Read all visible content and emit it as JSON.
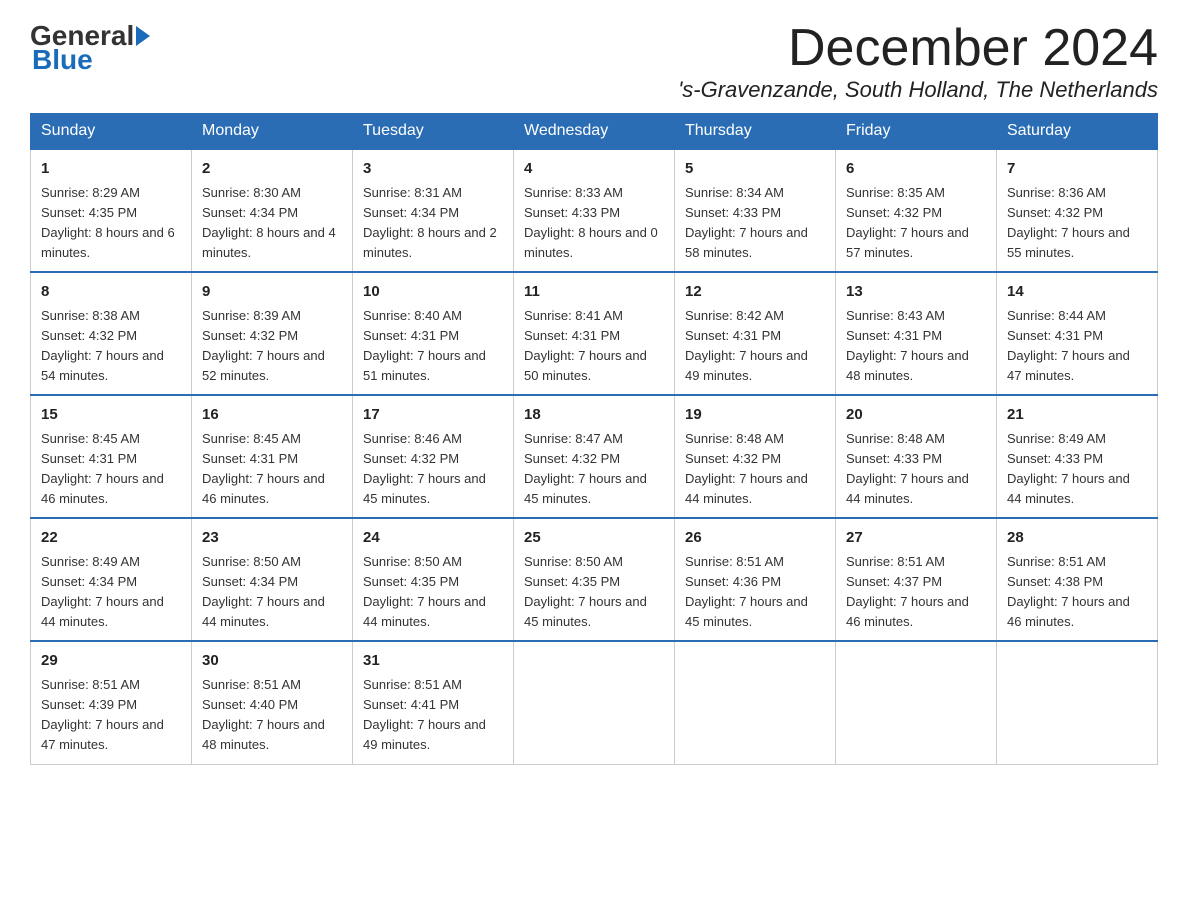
{
  "header": {
    "logo_general": "General",
    "logo_blue": "Blue",
    "month_title": "December 2024",
    "location": "'s-Gravenzande, South Holland, The Netherlands"
  },
  "weekdays": [
    "Sunday",
    "Monday",
    "Tuesday",
    "Wednesday",
    "Thursday",
    "Friday",
    "Saturday"
  ],
  "weeks": [
    [
      {
        "day": "1",
        "sunrise": "8:29 AM",
        "sunset": "4:35 PM",
        "daylight": "8 hours and 6 minutes."
      },
      {
        "day": "2",
        "sunrise": "8:30 AM",
        "sunset": "4:34 PM",
        "daylight": "8 hours and 4 minutes."
      },
      {
        "day": "3",
        "sunrise": "8:31 AM",
        "sunset": "4:34 PM",
        "daylight": "8 hours and 2 minutes."
      },
      {
        "day": "4",
        "sunrise": "8:33 AM",
        "sunset": "4:33 PM",
        "daylight": "8 hours and 0 minutes."
      },
      {
        "day": "5",
        "sunrise": "8:34 AM",
        "sunset": "4:33 PM",
        "daylight": "7 hours and 58 minutes."
      },
      {
        "day": "6",
        "sunrise": "8:35 AM",
        "sunset": "4:32 PM",
        "daylight": "7 hours and 57 minutes."
      },
      {
        "day": "7",
        "sunrise": "8:36 AM",
        "sunset": "4:32 PM",
        "daylight": "7 hours and 55 minutes."
      }
    ],
    [
      {
        "day": "8",
        "sunrise": "8:38 AM",
        "sunset": "4:32 PM",
        "daylight": "7 hours and 54 minutes."
      },
      {
        "day": "9",
        "sunrise": "8:39 AM",
        "sunset": "4:32 PM",
        "daylight": "7 hours and 52 minutes."
      },
      {
        "day": "10",
        "sunrise": "8:40 AM",
        "sunset": "4:31 PM",
        "daylight": "7 hours and 51 minutes."
      },
      {
        "day": "11",
        "sunrise": "8:41 AM",
        "sunset": "4:31 PM",
        "daylight": "7 hours and 50 minutes."
      },
      {
        "day": "12",
        "sunrise": "8:42 AM",
        "sunset": "4:31 PM",
        "daylight": "7 hours and 49 minutes."
      },
      {
        "day": "13",
        "sunrise": "8:43 AM",
        "sunset": "4:31 PM",
        "daylight": "7 hours and 48 minutes."
      },
      {
        "day": "14",
        "sunrise": "8:44 AM",
        "sunset": "4:31 PM",
        "daylight": "7 hours and 47 minutes."
      }
    ],
    [
      {
        "day": "15",
        "sunrise": "8:45 AM",
        "sunset": "4:31 PM",
        "daylight": "7 hours and 46 minutes."
      },
      {
        "day": "16",
        "sunrise": "8:45 AM",
        "sunset": "4:31 PM",
        "daylight": "7 hours and 46 minutes."
      },
      {
        "day": "17",
        "sunrise": "8:46 AM",
        "sunset": "4:32 PM",
        "daylight": "7 hours and 45 minutes."
      },
      {
        "day": "18",
        "sunrise": "8:47 AM",
        "sunset": "4:32 PM",
        "daylight": "7 hours and 45 minutes."
      },
      {
        "day": "19",
        "sunrise": "8:48 AM",
        "sunset": "4:32 PM",
        "daylight": "7 hours and 44 minutes."
      },
      {
        "day": "20",
        "sunrise": "8:48 AM",
        "sunset": "4:33 PM",
        "daylight": "7 hours and 44 minutes."
      },
      {
        "day": "21",
        "sunrise": "8:49 AM",
        "sunset": "4:33 PM",
        "daylight": "7 hours and 44 minutes."
      }
    ],
    [
      {
        "day": "22",
        "sunrise": "8:49 AM",
        "sunset": "4:34 PM",
        "daylight": "7 hours and 44 minutes."
      },
      {
        "day": "23",
        "sunrise": "8:50 AM",
        "sunset": "4:34 PM",
        "daylight": "7 hours and 44 minutes."
      },
      {
        "day": "24",
        "sunrise": "8:50 AM",
        "sunset": "4:35 PM",
        "daylight": "7 hours and 44 minutes."
      },
      {
        "day": "25",
        "sunrise": "8:50 AM",
        "sunset": "4:35 PM",
        "daylight": "7 hours and 45 minutes."
      },
      {
        "day": "26",
        "sunrise": "8:51 AM",
        "sunset": "4:36 PM",
        "daylight": "7 hours and 45 minutes."
      },
      {
        "day": "27",
        "sunrise": "8:51 AM",
        "sunset": "4:37 PM",
        "daylight": "7 hours and 46 minutes."
      },
      {
        "day": "28",
        "sunrise": "8:51 AM",
        "sunset": "4:38 PM",
        "daylight": "7 hours and 46 minutes."
      }
    ],
    [
      {
        "day": "29",
        "sunrise": "8:51 AM",
        "sunset": "4:39 PM",
        "daylight": "7 hours and 47 minutes."
      },
      {
        "day": "30",
        "sunrise": "8:51 AM",
        "sunset": "4:40 PM",
        "daylight": "7 hours and 48 minutes."
      },
      {
        "day": "31",
        "sunrise": "8:51 AM",
        "sunset": "4:41 PM",
        "daylight": "7 hours and 49 minutes."
      },
      null,
      null,
      null,
      null
    ]
  ]
}
